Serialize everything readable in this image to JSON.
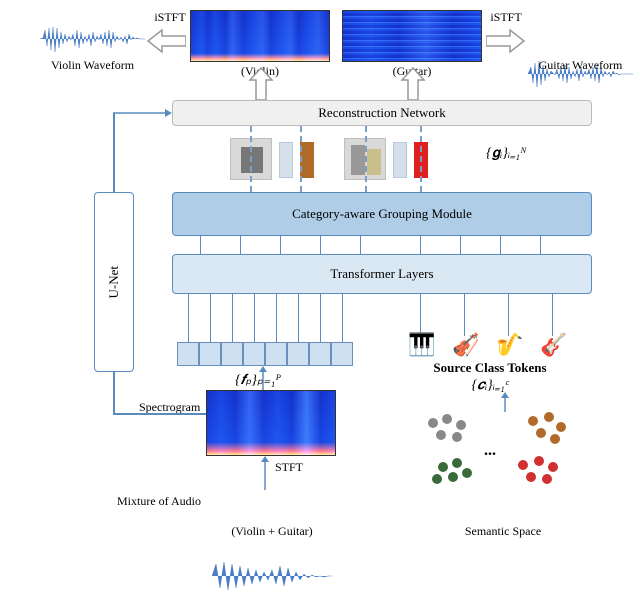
{
  "top": {
    "violin_wave_label": "Violin Waveform",
    "guitar_wave_label": "Guitar Waveform",
    "istft_left": "iSTFT",
    "istft_right": "iSTFT",
    "violin_caption": "(Violin)",
    "guitar_caption": "(Guitar)"
  },
  "blocks": {
    "reconstruction": "Reconstruction Network",
    "grouping": "Category-aware Grouping Module",
    "transformer": "Transformer Layers",
    "unet": "U-Net"
  },
  "symbols": {
    "gi": "{𝐠ᵢ}ᵢ₌₁ᴺ",
    "fp": "{𝒇ₚ}ₚ₌₁ᴾ",
    "ci": "{𝒄ᵢ}ᵢ₌₁ᶜ"
  },
  "mid": {
    "spectrogram": "Spectrogram",
    "stft": "STFT",
    "source_tokens": "Source Class Tokens",
    "icons": [
      "🎹",
      "🎻",
      "🎷",
      "🎸"
    ]
  },
  "bottom": {
    "mixture": "Mixture of Audio",
    "mixture_caption": "(Violin + Guitar)",
    "semantic": "Semantic Space",
    "dots_ellipsis": "..."
  },
  "colors": {
    "wave_blue": "#4a7dc9",
    "box_border": "#5a8bbf",
    "grouping_bg": "#afcde6",
    "transformer_bg": "#dae8f3"
  }
}
